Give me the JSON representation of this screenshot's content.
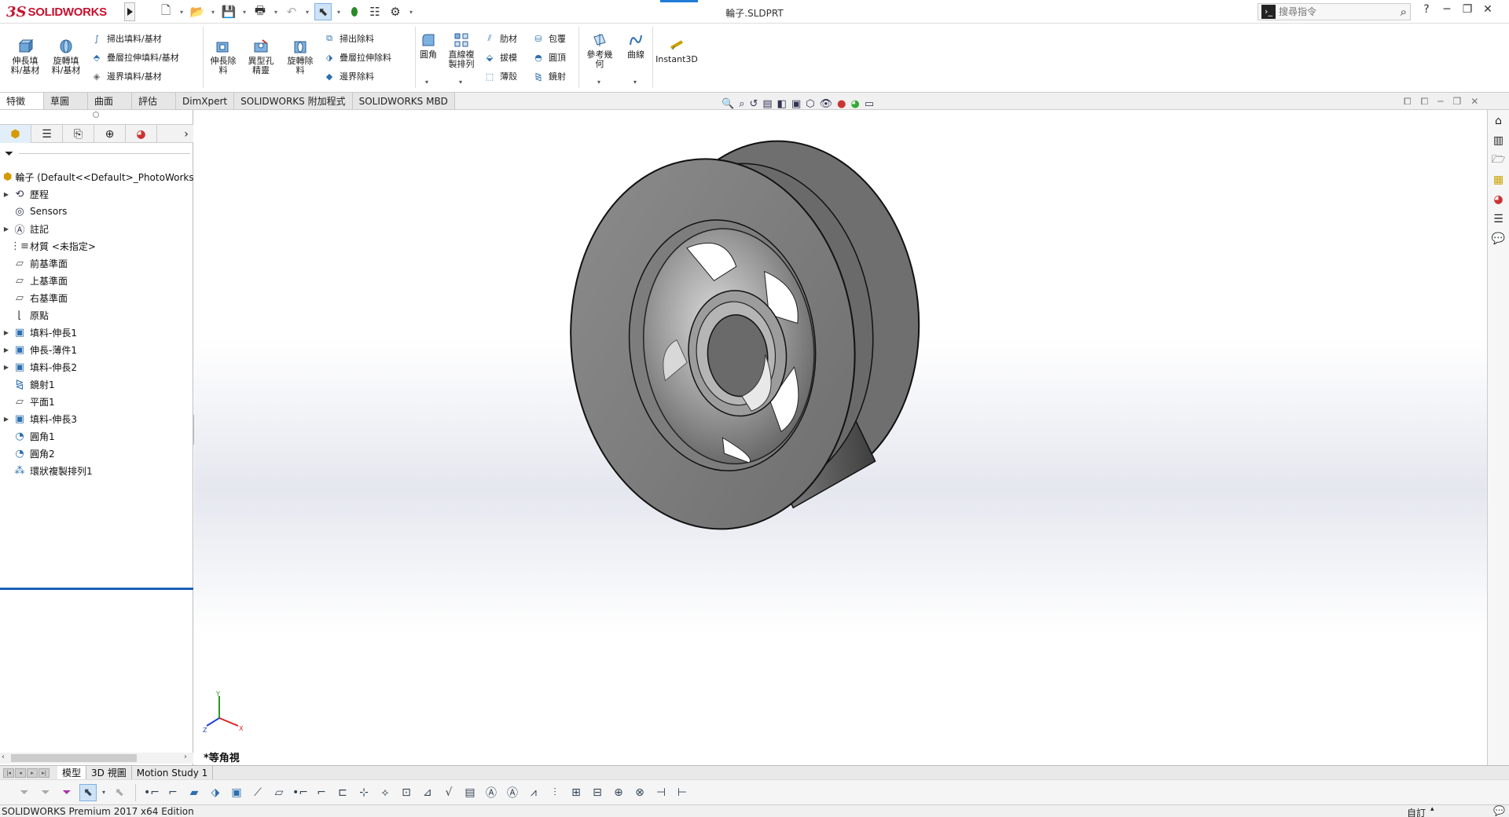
{
  "app": {
    "brand_ds": "3S",
    "brand_name": "SOLIDWORKS",
    "document_title": "輪子.SLDPRT",
    "search_placeholder": "搜尋指令",
    "accent_color": "#1e7bd6",
    "brand_color": "#c8102e"
  },
  "quick_access": {
    "icons": [
      "new-file-icon",
      "open-file-icon",
      "save-icon",
      "print-icon",
      "undo-icon",
      "select-icon",
      "rebuild-icon",
      "file-properties-icon",
      "options-icon"
    ]
  },
  "ribbon": {
    "extrude_boss": "伸長填\n料/基材",
    "revolve_boss": "旋轉填\n料/基材",
    "swept_boss": "掃出填料/基材",
    "loft_boss": "疊層拉伸填料/基材",
    "boundary_boss": "邊界填料/基材",
    "extrude_cut": "伸長除\n料",
    "hole_wizard": "異型孔\n精靈",
    "revolve_cut": "旋轉除\n料",
    "swept_cut": "掃出除料",
    "loft_cut": "疊層拉伸除料",
    "boundary_cut": "邊界除料",
    "fillet": "圓角",
    "linear_pattern": "直線複\n製排列",
    "rib": "肋材",
    "draft": "拔模",
    "shell": "薄殼",
    "wrap": "包覆",
    "dome": "圓頂",
    "mirror": "鏡射",
    "ref_geometry": "參考幾\n何",
    "curves": "曲線",
    "instant3d": "Instant3D"
  },
  "command_tabs": [
    "特徵",
    "草圖",
    "曲面",
    "評估",
    "DimXpert",
    "SOLIDWORKS 附加程式",
    "SOLIDWORKS MBD"
  ],
  "feature_tree": {
    "root": "輪子  (Default<<Default>_PhotoWorks",
    "items": [
      {
        "label": "歷程",
        "expandable": true,
        "icon": "history-icon"
      },
      {
        "label": "Sensors",
        "expandable": false,
        "icon": "sensors-icon"
      },
      {
        "label": "註記",
        "expandable": true,
        "icon": "annotations-icon"
      },
      {
        "label": "材質 <未指定>",
        "expandable": false,
        "icon": "material-icon"
      },
      {
        "label": "前基準面",
        "expandable": false,
        "icon": "plane-icon"
      },
      {
        "label": "上基準面",
        "expandable": false,
        "icon": "plane-icon"
      },
      {
        "label": "右基準面",
        "expandable": false,
        "icon": "plane-icon"
      },
      {
        "label": "原點",
        "expandable": false,
        "icon": "origin-icon"
      },
      {
        "label": "填料-伸長1",
        "expandable": true,
        "icon": "extrude-icon"
      },
      {
        "label": "伸長-薄件1",
        "expandable": true,
        "icon": "extrude-icon"
      },
      {
        "label": "填料-伸長2",
        "expandable": true,
        "icon": "extrude-icon"
      },
      {
        "label": "鏡射1",
        "expandable": false,
        "icon": "mirror-icon"
      },
      {
        "label": "平面1",
        "expandable": false,
        "icon": "plane-icon"
      },
      {
        "label": "填料-伸長3",
        "expandable": true,
        "icon": "extrude-icon"
      },
      {
        "label": "圓角1",
        "expandable": false,
        "icon": "fillet-icon"
      },
      {
        "label": "圓角2",
        "expandable": false,
        "icon": "fillet-icon"
      },
      {
        "label": "環狀複製排列1",
        "expandable": false,
        "icon": "circular-pattern-icon"
      }
    ]
  },
  "viewport": {
    "view_name": "*等角視",
    "triad": {
      "x": "X",
      "y": "Y",
      "z": "Z"
    }
  },
  "bottom_tabs": [
    "模型",
    "3D 視圖",
    "Motion Study 1"
  ],
  "status_bar": {
    "text": "SOLIDWORKS Premium 2017 x64 Edition",
    "custom": "自訂"
  }
}
